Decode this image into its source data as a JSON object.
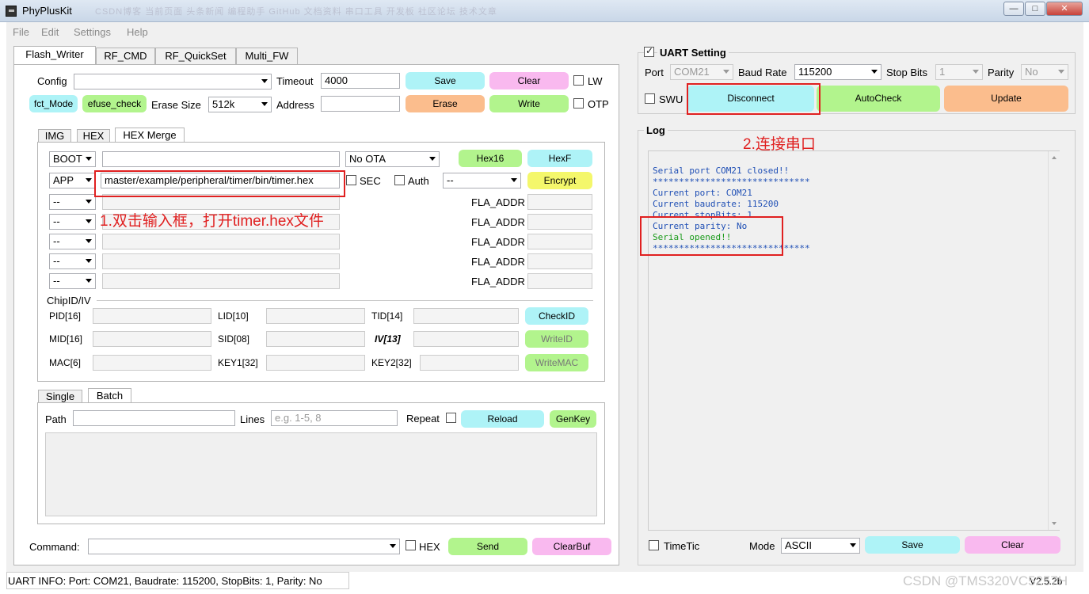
{
  "window": {
    "title": "PhyPlusKit",
    "blurred_tabs": "CSDN博客   当前页面   头条新闻   编程助手   GitHub   文档资料   串口工具   开发板   社区论坛   技术文章"
  },
  "menu": [
    "File",
    "Edit",
    "Settings",
    "Help"
  ],
  "main_tabs": [
    "Flash_Writer",
    "RF_CMD",
    "RF_QuickSet",
    "Multi_FW"
  ],
  "config": {
    "config_label": "Config",
    "config_value": "",
    "timeout_label": "Timeout",
    "timeout_value": "4000",
    "save": "Save",
    "clear": "Clear",
    "lw": "LW",
    "fct_mode": "fct_Mode",
    "efuse_check": "efuse_check",
    "erase_size_label": "Erase Size",
    "erase_size_value": "512k",
    "address_label": "Address",
    "address_value": "",
    "erase": "Erase",
    "write": "Write",
    "otp": "OTP"
  },
  "hex_tabs": [
    "IMG",
    "HEX",
    "HEX Merge"
  ],
  "hex_merge": {
    "boot_sel": "BOOT",
    "ota_sel": "No OTA",
    "hex16": "Hex16",
    "hexf": "HexF",
    "app_sel": "APP",
    "app_path": "master/example/peripheral/timer/bin/timer.hex",
    "sec": "SEC",
    "auth": "Auth",
    "auth_sel": "--",
    "encrypt": "Encrypt",
    "empty_sel": "--",
    "fla_addr": "FLA_ADDR"
  },
  "chipid": {
    "title": "ChipID/IV",
    "pid": "PID[16]",
    "lid": "LID[10]",
    "tid": "TID[14]",
    "checkid": "CheckID",
    "mid": "MID[16]",
    "sid": "SID[08]",
    "iv": "IV[13]",
    "writeid": "WriteID",
    "mac": "MAC[6]",
    "key1": "KEY1[32]",
    "key2": "KEY2[32]",
    "writemac": "WriteMAC"
  },
  "batch_tabs": [
    "Single",
    "Batch"
  ],
  "batch": {
    "path_label": "Path",
    "lines_label": "Lines",
    "lines_placeholder": "e.g. 1-5, 8",
    "repeat": "Repeat",
    "reload": "Reload",
    "genkey": "GenKey"
  },
  "command": {
    "label": "Command:",
    "hex": "HEX",
    "send": "Send",
    "clearbuf": "ClearBuf"
  },
  "status_bar": "UART INFO: Port: COM21, Baudrate: 115200, StopBits: 1, Parity: No",
  "uart": {
    "title": "UART Setting",
    "port_label": "Port",
    "port_value": "COM21",
    "baud_label": "Baud Rate",
    "baud_value": "115200",
    "stop_label": "Stop Bits",
    "stop_value": "1",
    "parity_label": "Parity",
    "parity_value": "No",
    "swu": "SWU",
    "disconnect": "Disconnect",
    "autocheck": "AutoCheck",
    "update": "Update"
  },
  "log": {
    "title": "Log",
    "lines": [
      "Serial port COM21 closed!!",
      "******************************",
      "Current port: COM21",
      "Current baudrate: 115200",
      "Current stopBits: 1",
      "Current parity: No",
      "Serial opened!!",
      "******************************"
    ],
    "timetic": "TimeTic",
    "mode_label": "Mode",
    "mode_value": "ASCII",
    "save": "Save",
    "clear": "Clear"
  },
  "annotations": {
    "step1": "1.双击输入框，打开timer.hex文件",
    "step2": "2.连接串口"
  },
  "version": "V2.5.2b",
  "watermark": "CSDN @TMS320VC5257H",
  "colors": {
    "cyan": "#aef3f7",
    "pink": "#f9b9ef",
    "orange": "#fbbd8d",
    "green": "#b2f48d",
    "yellow": "#f4f76b",
    "annotation_red": "#e02020",
    "log_blue": "#1f4fb5",
    "log_green": "#1a9a1a"
  }
}
